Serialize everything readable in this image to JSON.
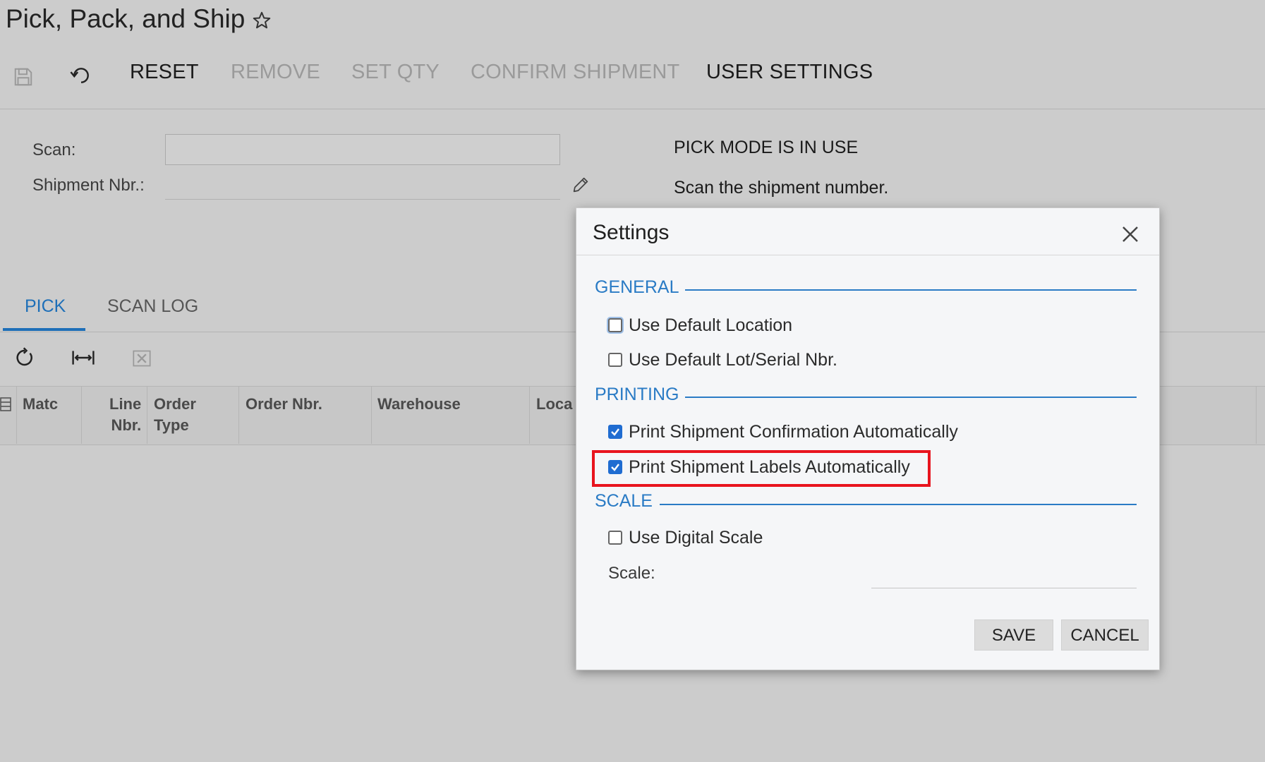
{
  "header": {
    "title": "Pick, Pack, and Ship"
  },
  "toolbar": {
    "reset": "RESET",
    "remove": "REMOVE",
    "set_qty": "SET QTY",
    "confirm_shipment": "CONFIRM SHIPMENT",
    "user_settings": "USER SETTINGS"
  },
  "form": {
    "scan_label": "Scan:",
    "scan_value": "",
    "shipment_label": "Shipment Nbr.:",
    "shipment_value": ""
  },
  "status": {
    "title": "PICK MODE IS IN USE",
    "message": "Scan the shipment number."
  },
  "tabs": [
    {
      "label": "PICK",
      "active": true
    },
    {
      "label": "SCAN LOG",
      "active": false
    }
  ],
  "grid": {
    "columns": [
      {
        "line1": "Matc",
        "line2": ""
      },
      {
        "line1": "Line",
        "line2": "Nbr."
      },
      {
        "line1": "Order",
        "line2": "Type"
      },
      {
        "line1": "Order Nbr.",
        "line2": ""
      },
      {
        "line1": "Warehouse",
        "line2": ""
      },
      {
        "line1": "Loca",
        "line2": ""
      }
    ]
  },
  "dialog": {
    "title": "Settings",
    "sections": {
      "general": "GENERAL",
      "printing": "PRINTING",
      "scale": "SCALE"
    },
    "options": {
      "use_default_location": {
        "label": "Use Default Location",
        "checked": false
      },
      "use_default_lot": {
        "label": "Use Default Lot/Serial Nbr.",
        "checked": false
      },
      "print_confirmation": {
        "label": "Print Shipment Confirmation Automatically",
        "checked": true
      },
      "print_labels": {
        "label": "Print Shipment Labels Automatically",
        "checked": true
      },
      "use_digital_scale": {
        "label": "Use Digital Scale",
        "checked": false
      }
    },
    "scale_label": "Scale:",
    "scale_value": "",
    "save": "SAVE",
    "cancel": "CANCEL"
  },
  "colors": {
    "accent": "#2a7bc5",
    "highlight": "#e8141e",
    "checkbox_checked": "#1f6cd1"
  }
}
